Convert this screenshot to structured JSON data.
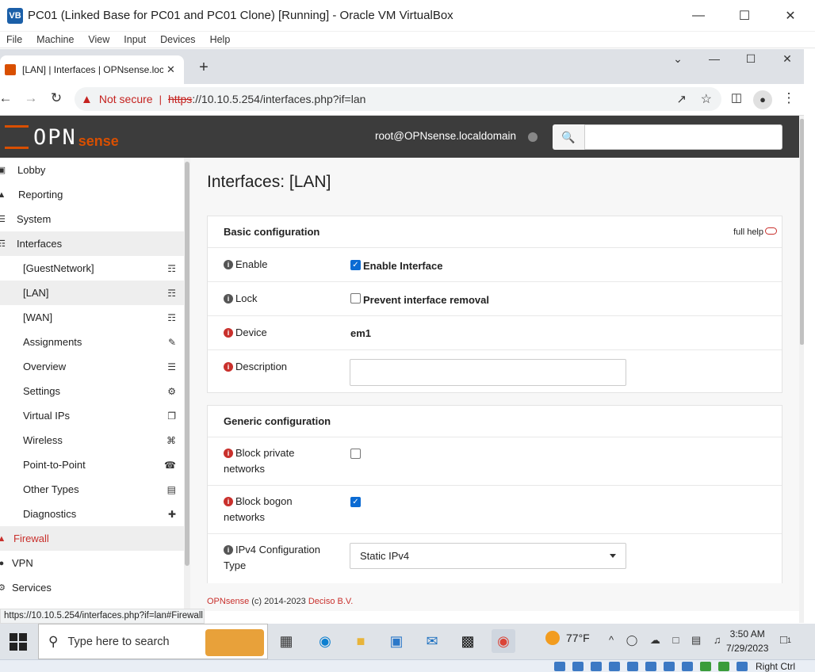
{
  "vbox": {
    "title": "PC01 (Linked Base for PC01 and PC01 Clone) [Running] - Oracle VM VirtualBox",
    "menu": [
      "File",
      "Machine",
      "View",
      "Input",
      "Devices",
      "Help"
    ],
    "host_key": "Right Ctrl"
  },
  "browser": {
    "tab_title": "[LAN] | Interfaces | OPNsense.localdomain",
    "not_secure": "Not secure",
    "url_scheme": "https",
    "url_rest": "://10.10.5.254/interfaces.php?if=lan",
    "status_url": "https://10.10.5.254/interfaces.php?if=lan#Firewall"
  },
  "header": {
    "logo_main": "OPN",
    "logo_sub": "sense",
    "user": "root@OPNsense.localdomain"
  },
  "sidebar": {
    "top": [
      {
        "label": "Lobby",
        "icon": "laptop-icon"
      },
      {
        "label": "Reporting",
        "icon": "area-chart-icon"
      },
      {
        "label": "System",
        "icon": "server-icon"
      },
      {
        "label": "Interfaces",
        "icon": "sitemap-icon"
      }
    ],
    "sub": [
      {
        "label": "[GuestNetwork]",
        "icon": "sitemap-icon"
      },
      {
        "label": "[LAN]",
        "icon": "sitemap-icon"
      },
      {
        "label": "[WAN]",
        "icon": "sitemap-icon"
      },
      {
        "label": "Assignments",
        "icon": "pencil-icon"
      },
      {
        "label": "Overview",
        "icon": "tasks-icon"
      },
      {
        "label": "Settings",
        "icon": "cogs-icon"
      },
      {
        "label": "Virtual IPs",
        "icon": "clone-icon"
      },
      {
        "label": "Wireless",
        "icon": "wifi-icon"
      },
      {
        "label": "Point-to-Point",
        "icon": "phone-icon"
      },
      {
        "label": "Other Types",
        "icon": "archive-icon"
      },
      {
        "label": "Diagnostics",
        "icon": "medkit-icon"
      }
    ],
    "bottom": [
      {
        "label": "Firewall",
        "icon": "fire-icon"
      },
      {
        "label": "VPN",
        "icon": "globe-icon"
      },
      {
        "label": "Services",
        "icon": "cog-icon"
      }
    ]
  },
  "page": {
    "title": "Interfaces: [LAN]",
    "full_help": "full help",
    "basic": {
      "heading": "Basic configuration",
      "enable_label": "Enable",
      "enable_text": "Enable Interface",
      "enable_checked": true,
      "lock_label": "Lock",
      "lock_text": "Prevent interface removal",
      "lock_checked": false,
      "device_label": "Device",
      "device_value": "em1",
      "description_label": "Description",
      "description_value": ""
    },
    "generic": {
      "heading": "Generic configuration",
      "block_private_label": "Block private networks",
      "block_private_checked": false,
      "block_bogon_label": "Block bogon networks",
      "block_bogon_checked": true,
      "ipv4_label": "IPv4 Configuration Type",
      "ipv4_value": "Static IPv4"
    },
    "footer_brand": "OPNsense",
    "footer_mid": " (c) 2014-2023 ",
    "footer_company": "Deciso B.V."
  },
  "taskbar": {
    "search_placeholder": "Type here to search",
    "weather": "77°F",
    "time": "3:50 AM",
    "date": "7/29/2023",
    "notif_count": "1"
  }
}
